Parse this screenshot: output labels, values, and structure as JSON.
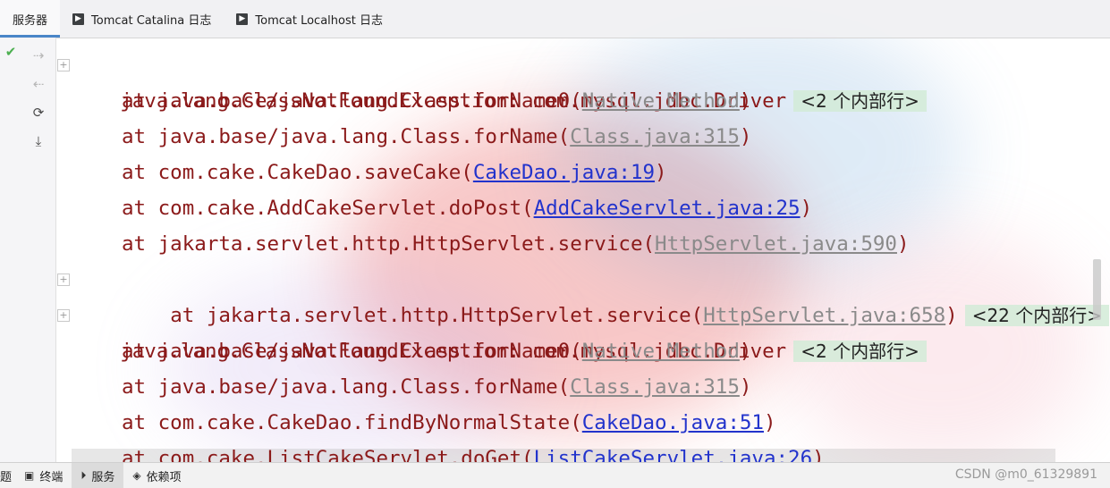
{
  "tabs": [
    {
      "label": "服务器",
      "icon": ""
    },
    {
      "label": "Tomcat Catalina 日志",
      "icon": "terminal-icon"
    },
    {
      "label": "Tomcat Localhost 日志",
      "icon": "terminal-icon"
    }
  ],
  "console": {
    "lines": [
      {
        "text": "java.lang.ClassNotFoundException: com.mysql.jdbc.Driver",
        "badge": "<2 个内部行>"
      },
      {
        "prefix": "at java.base/java.lang.Class.forName0(",
        "link": "Native Method",
        "suffix": ")"
      },
      {
        "prefix": "at java.base/java.lang.Class.forName(",
        "link": "Class.java:315",
        "suffix": ")"
      },
      {
        "prefix": "at com.cake.CakeDao.saveCake(",
        "link": "CakeDao.java:19",
        "suffix": ")"
      },
      {
        "prefix": "at com.cake.AddCakeServlet.doPost(",
        "link": "AddCakeServlet.java:25",
        "suffix": ")"
      },
      {
        "prefix": "at jakarta.servlet.http.HttpServlet.service(",
        "link": "HttpServlet.java:590",
        "suffix": ")"
      },
      {
        "prefix": "at jakarta.servlet.http.HttpServlet.service(",
        "link": "HttpServlet.java:658",
        "suffix": ")",
        "badge": "<22 个内部行>"
      },
      {
        "text": "java.lang.ClassNotFoundException: com.mysql.jdbc.Driver",
        "badge": "<2 个内部行>"
      },
      {
        "prefix": "at java.base/java.lang.Class.forName0(",
        "link": "Native Method",
        "suffix": ")"
      },
      {
        "prefix": "at java.base/java.lang.Class.forName(",
        "link": "Class.java:315",
        "suffix": ")"
      },
      {
        "prefix": "at com.cake.CakeDao.findByNormalState(",
        "link": "CakeDao.java:51",
        "suffix": ")"
      },
      {
        "prefix": "at com.cake.ListCakeServlet.doGet(",
        "link": "ListCakeServlet.java:26",
        "suffix": ")"
      }
    ]
  },
  "bottom": {
    "edge_label": "题",
    "tabs": [
      {
        "label": "终端",
        "icon": "terminal-icon"
      },
      {
        "label": "服务",
        "icon": "play-icon"
      },
      {
        "label": "依赖项",
        "icon": "layers-icon"
      }
    ]
  },
  "watermark": "CSDN @m0_61329891",
  "colors": {
    "exception_text": "#8b1a1a",
    "link_blue": "#2233cc",
    "link_gray": "#8a8a8a",
    "badge_bg": "#d2ebd7",
    "check_green": "#4caf50"
  }
}
